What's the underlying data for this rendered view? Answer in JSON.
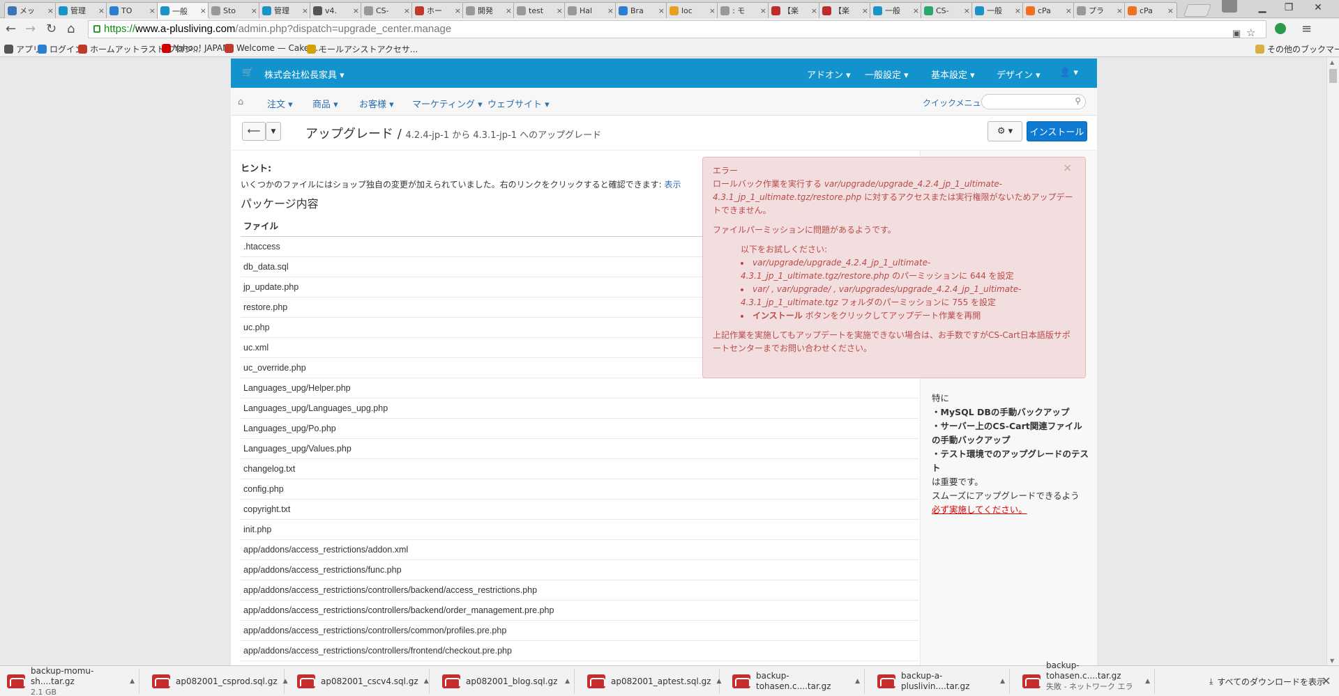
{
  "browser": {
    "tabs": [
      {
        "label": "メッ",
        "icon": "cs-cart-icon",
        "color": "#3b74b8"
      },
      {
        "label": "管理",
        "icon": "cs-cart-icon",
        "color": "#1a94c7"
      },
      {
        "label": "TO",
        "icon": "at-icon",
        "color": "#2a7fd0"
      },
      {
        "label": "一般",
        "icon": "cs-cart-icon",
        "color": "#1a94c7",
        "active": true
      },
      {
        "label": "Sto",
        "icon": "document-icon",
        "color": "#999999"
      },
      {
        "label": "管理",
        "icon": "cs-cart-icon",
        "color": "#1a94c7"
      },
      {
        "label": "v4.",
        "icon": "mail-icon",
        "color": "#555555"
      },
      {
        "label": "CS-",
        "icon": "document-icon",
        "color": "#999999"
      },
      {
        "label": "ホー",
        "icon": "home-icon",
        "color": "#c0392b"
      },
      {
        "label": "開発",
        "icon": "document-icon",
        "color": "#999999"
      },
      {
        "label": "test",
        "icon": "document-icon",
        "color": "#999999"
      },
      {
        "label": "Hal",
        "icon": "document-icon",
        "color": "#999999"
      },
      {
        "label": "Bra",
        "icon": "ui-icon",
        "color": "#2a7fd0"
      },
      {
        "label": "loc",
        "icon": "pma-icon",
        "color": "#e8a020"
      },
      {
        "label": ": モ",
        "icon": "document-icon",
        "color": "#999999"
      },
      {
        "label": "【楽",
        "icon": "r-icon",
        "color": "#bf2a2a"
      },
      {
        "label": "【楽",
        "icon": "r-icon",
        "color": "#bf2a2a"
      },
      {
        "label": "一般",
        "icon": "cs-cart-icon",
        "color": "#1a94c7"
      },
      {
        "label": "CS-",
        "icon": "puzzle-icon",
        "color": "#2aa86a"
      },
      {
        "label": "一般",
        "icon": "cs-cart-icon",
        "color": "#1a94c7"
      },
      {
        "label": "cPa",
        "icon": "cpanel-icon",
        "color": "#f07020"
      },
      {
        "label": "プラ",
        "icon": "document-icon",
        "color": "#999999"
      },
      {
        "label": "cPa",
        "icon": "cpanel-icon",
        "color": "#f07020"
      }
    ],
    "close_glyph": "×",
    "window": {
      "minimize": "▁",
      "restore": "❐",
      "close": "✕"
    },
    "url": {
      "scheme": "https://",
      "host": "www.a-plusliving.com",
      "path": "/admin.php?dispatch=upgrade_center.manage"
    },
    "bookmarks": [
      {
        "label": "アプリ",
        "icon": "apps-icon",
        "color": "#555555"
      },
      {
        "label": "ログイン",
        "icon": "c-icon",
        "color": "#2a7fd0"
      },
      {
        "label": "ホームアットラスト プロジ...",
        "icon": "home-icon",
        "color": "#c0392b"
      },
      {
        "label": "Yahoo! JAPAN",
        "icon": "yahoo-icon",
        "color": "#d00000"
      },
      {
        "label": "Welcome — CakeP...",
        "icon": "cake-icon",
        "color": "#c0392b"
      },
      {
        "label": "モールアシストアクセサ...",
        "icon": "ma-icon",
        "color": "#d6a000"
      }
    ],
    "other_bookmarks": "その他のブックマーク"
  },
  "admin": {
    "store_name": "株式会社松長家具",
    "top_menu": [
      "アドオン",
      "一般設定",
      "基本設定",
      "デザイン"
    ],
    "sec_menu": [
      "注文",
      "商品",
      "お客様",
      "マーケティング",
      "ウェブサイト"
    ],
    "quick_menu": "クイックメニュー",
    "page_title": "アップグレード",
    "page_subtitle": "4.2.4-jp-1 から 4.3.1-jp-1 へのアップグレード",
    "install_button": "インストール",
    "hint_label": "ヒント:",
    "hint_text": "いくつかのファイルにはショップ独自の変更が加えられていました。右のリンクをクリックすると確認できます:",
    "hint_link": "表示",
    "package_heading": "パッケージ内容",
    "file_header": "ファイル",
    "files": [
      ".htaccess",
      "db_data.sql",
      "jp_update.php",
      "restore.php",
      "uc.php",
      "uc.xml",
      "uc_override.php",
      "Languages_upg/Helper.php",
      "Languages_upg/Languages_upg.php",
      "Languages_upg/Po.php",
      "Languages_upg/Values.php",
      "changelog.txt",
      "config.php",
      "copyright.txt",
      "init.php",
      "app/addons/access_restrictions/addon.xml",
      "app/addons/access_restrictions/func.php",
      "app/addons/access_restrictions/controllers/backend/access_restrictions.php",
      "app/addons/access_restrictions/controllers/backend/order_management.pre.php",
      "app/addons/access_restrictions/controllers/common/profiles.pre.php",
      "app/addons/access_restrictions/controllers/frontend/checkout.pre.php"
    ],
    "sidebar": {
      "lead": "特に",
      "items": [
        "・MySQL DBの手動バックアップ",
        "・サーバー上のCS-Cart関連ファイルの手動バックアップ",
        "・テスト環境でのアップグレードのテスト"
      ],
      "tail": "は重要です。",
      "note": "スムーズにアップグレードできるよう",
      "link": "必ず実施してください。"
    }
  },
  "error": {
    "title": "エラー",
    "line1_pre": "ロールバック作業を実行する",
    "line1_path": "var/upgrade/upgrade_4.2.4_jp_1_ultimate-4.3.1_jp_1_ultimate.tgz/restore.php",
    "line1_post": "に対するアクセスまたは実行権限がないためアップデートできません。",
    "perm_issue": "ファイルパーミッションに問題があるようです。",
    "try_label": "以下をお試しください:",
    "item1_path": "var/upgrade/upgrade_4.2.4_jp_1_ultimate-4.3.1_jp_1_ultimate.tgz/restore.php",
    "item1_post": "のパーミッションに 644 を設定",
    "item2_path": "var/ , var/upgrade/ , var/upgrades/upgrade_4.2.4_jp_1_ultimate-4.3.1_jp_1_ultimate.tgz",
    "item2_post": "フォルダのパーミッションに 755 を設定",
    "item3_bold": "インストール",
    "item3_post": "ボタンをクリックしてアップデート作業を再開",
    "footer": "上記作業を実施してもアップデートを実施できない場合は、お手数ですがCS-Cart日本語版サポートセンターまでお問い合わせください。",
    "close_glyph": "×"
  },
  "downloads": [
    {
      "name": "backup-momu-sh....tar.gz",
      "sub": "2.1 GB"
    },
    {
      "name": "ap082001_csprod.sql.gz",
      "sub": ""
    },
    {
      "name": "ap082001_cscv4.sql.gz",
      "sub": ""
    },
    {
      "name": "ap082001_blog.sql.gz",
      "sub": ""
    },
    {
      "name": "ap082001_aptest.sql.gz",
      "sub": ""
    },
    {
      "name": "backup-tohasen.c....tar.gz",
      "sub": ""
    },
    {
      "name": "backup-a-pluslivin....tar.gz",
      "sub": ""
    },
    {
      "name": "backup-tohasen.c....tar.gz",
      "sub": "失敗 - ネットワーク エラー"
    }
  ],
  "downloads_all": "すべてのダウンロードを表示",
  "colors": {
    "accent": "#1393cd",
    "install": "#0e7ad1",
    "error_bg": "#f2dede",
    "error_text": "#b94a48",
    "link": "#2a6fb0"
  }
}
